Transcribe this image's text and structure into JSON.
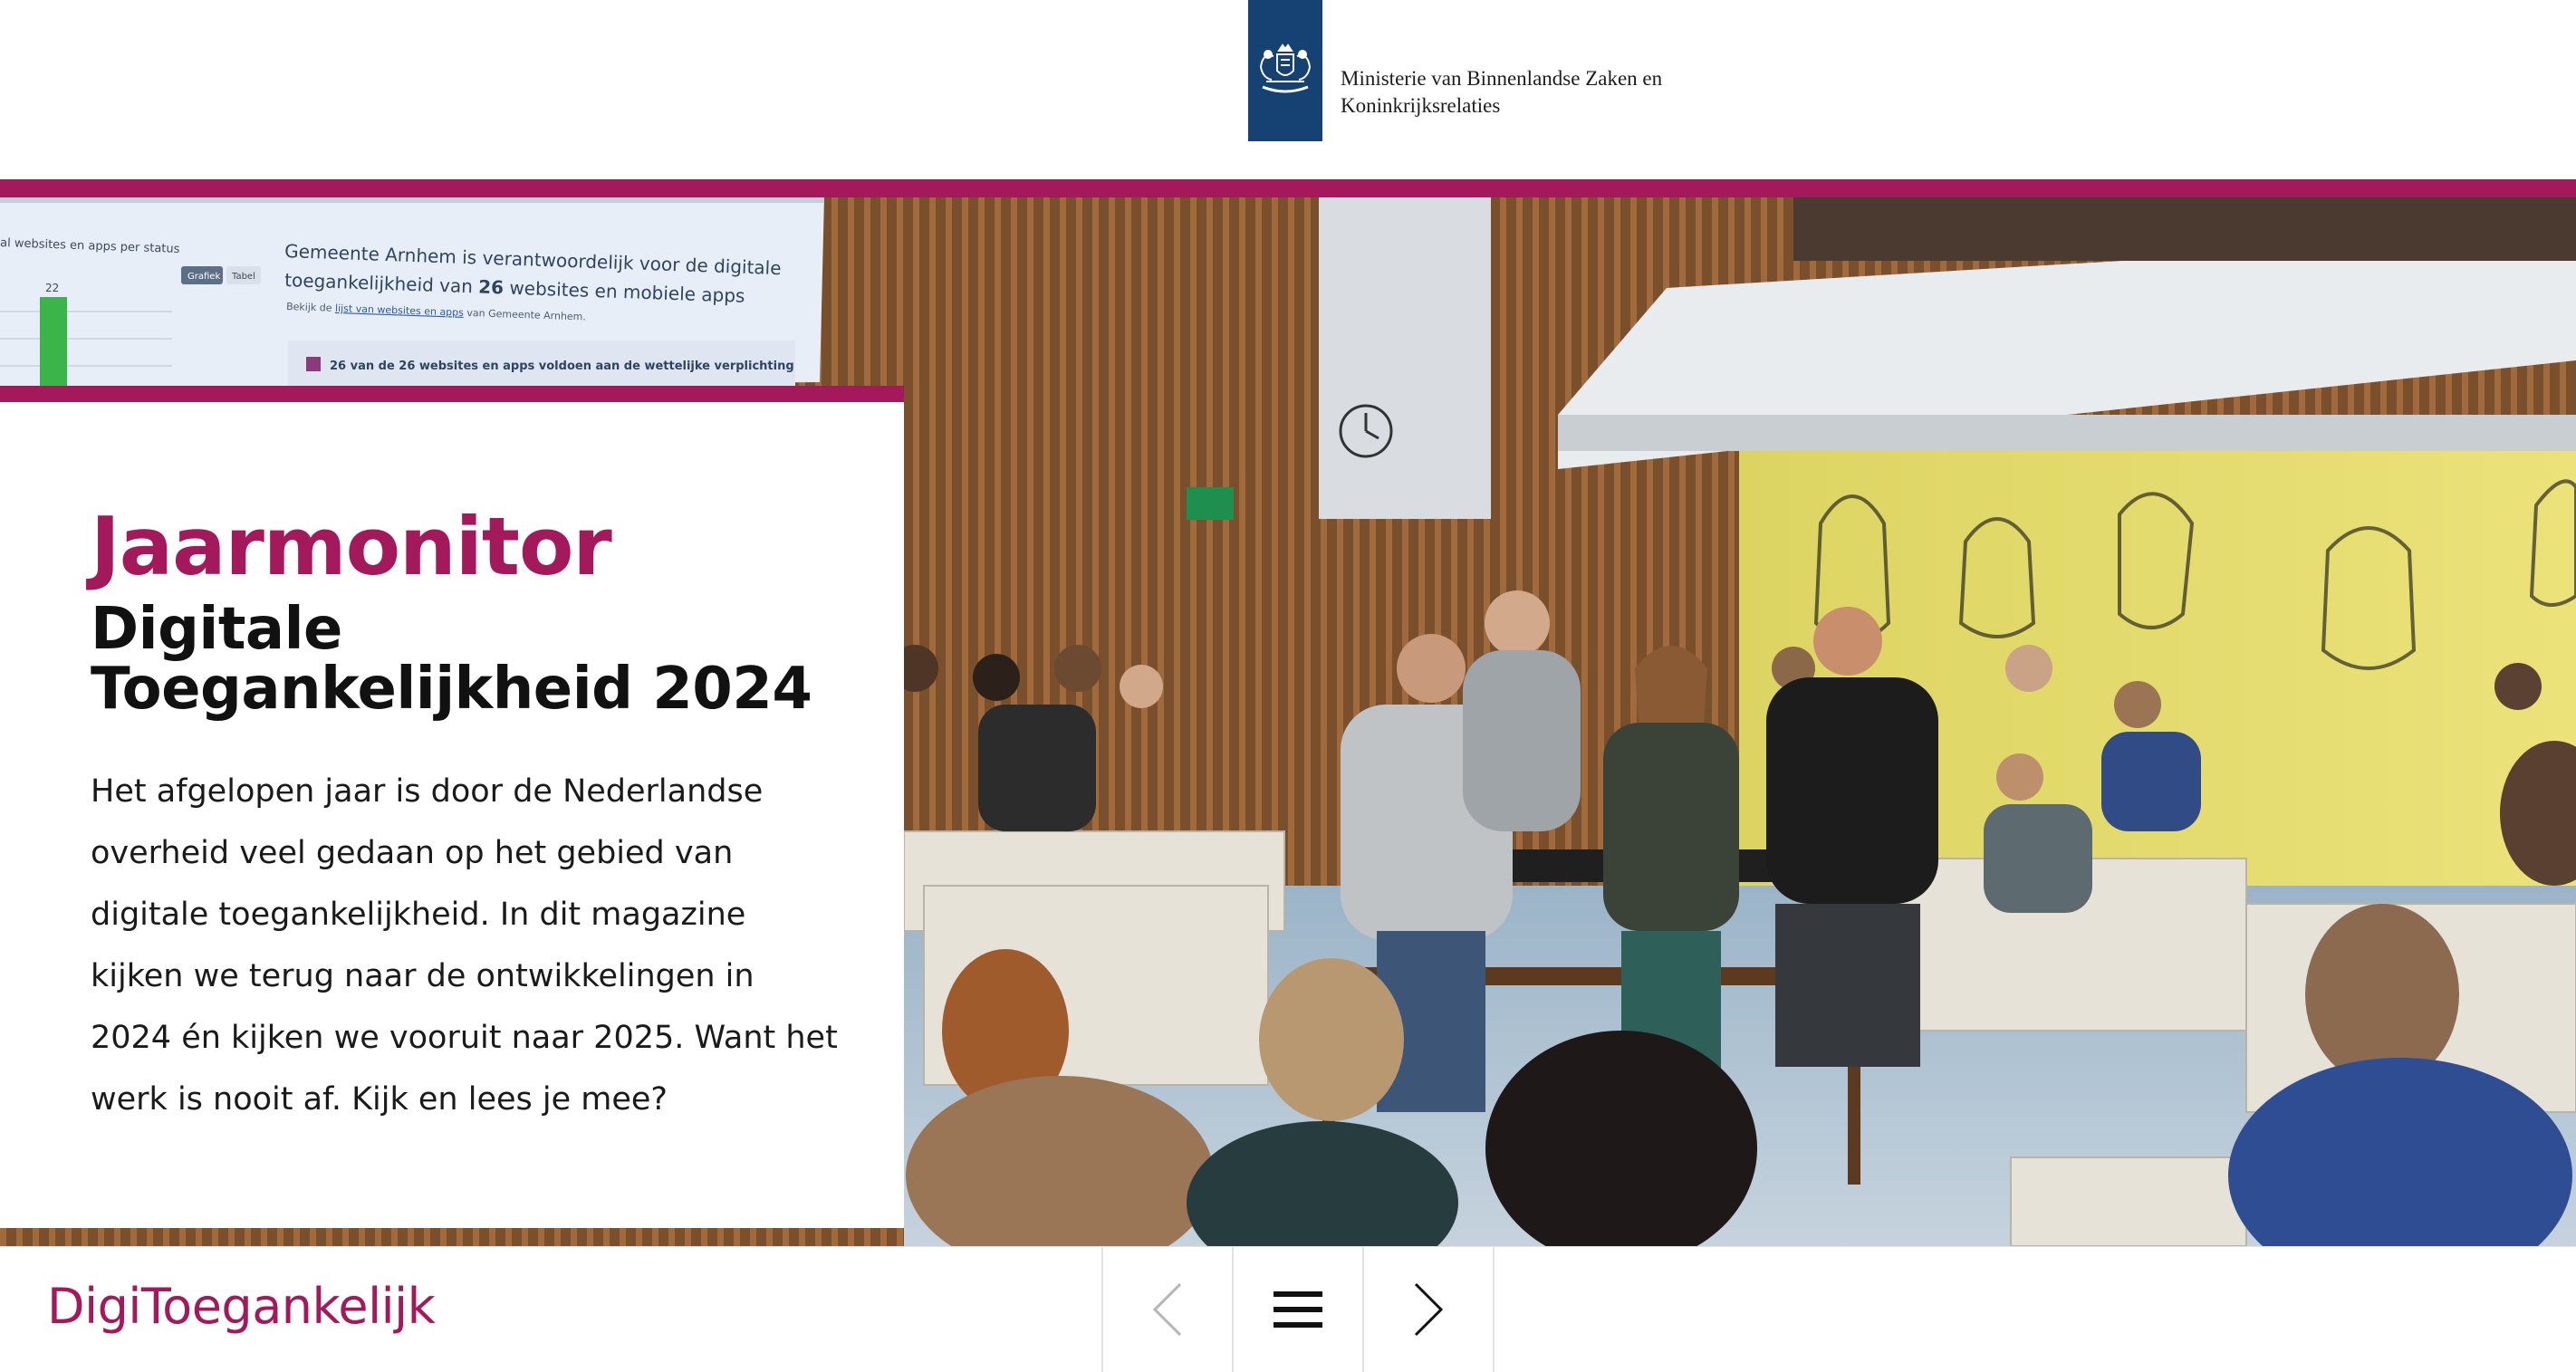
{
  "header": {
    "ministry_line1": "Ministerie van Binnenlandse Zaken en",
    "ministry_line2": "Koninkrijksrelaties",
    "logo_icon": "rijksoverheid-coat-of-arms-icon"
  },
  "hero": {
    "screen": {
      "chart_label": "al websites en apps per status",
      "tab_graph": "Grafiek",
      "tab_table": "Tabel",
      "bar_value": "22",
      "line1": "Gemeente Arnhem is verantwoordelijk voor de digitale",
      "line2_prefix": "toegankelijkheid van",
      "line2_number": "26",
      "line2_suffix": "websites en mobiele apps",
      "small_prefix": "Bekijk de",
      "small_link": "lijst van websites en apps",
      "small_suffix": "van Gemeente Arnhem.",
      "status_text": "26 van de 26 websites en apps voldoen aan de wettelijke verplichting"
    }
  },
  "card": {
    "title": "Jaarmonitor",
    "subtitle_line1": "Digitale",
    "subtitle_line2": "Toegankelijkheid 2024",
    "text": "Het afgelopen jaar is door de Nederlandse overheid veel gedaan op het gebied van digitale toegankelijkheid. In dit magazine kijken we terug naar de ontwikkelingen in 2024 én kijken we vooruit naar 2025. Want het werk is nooit af. Kijk en lees je mee?"
  },
  "footer": {
    "brand": "DigiToegankelijk",
    "prev_icon": "chevron-left-icon",
    "menu_icon": "hamburger-menu-icon",
    "next_icon": "chevron-right-icon"
  },
  "colors": {
    "brand": "#a3195b",
    "logo_blue": "#154273",
    "text": "#1a1a1a"
  }
}
